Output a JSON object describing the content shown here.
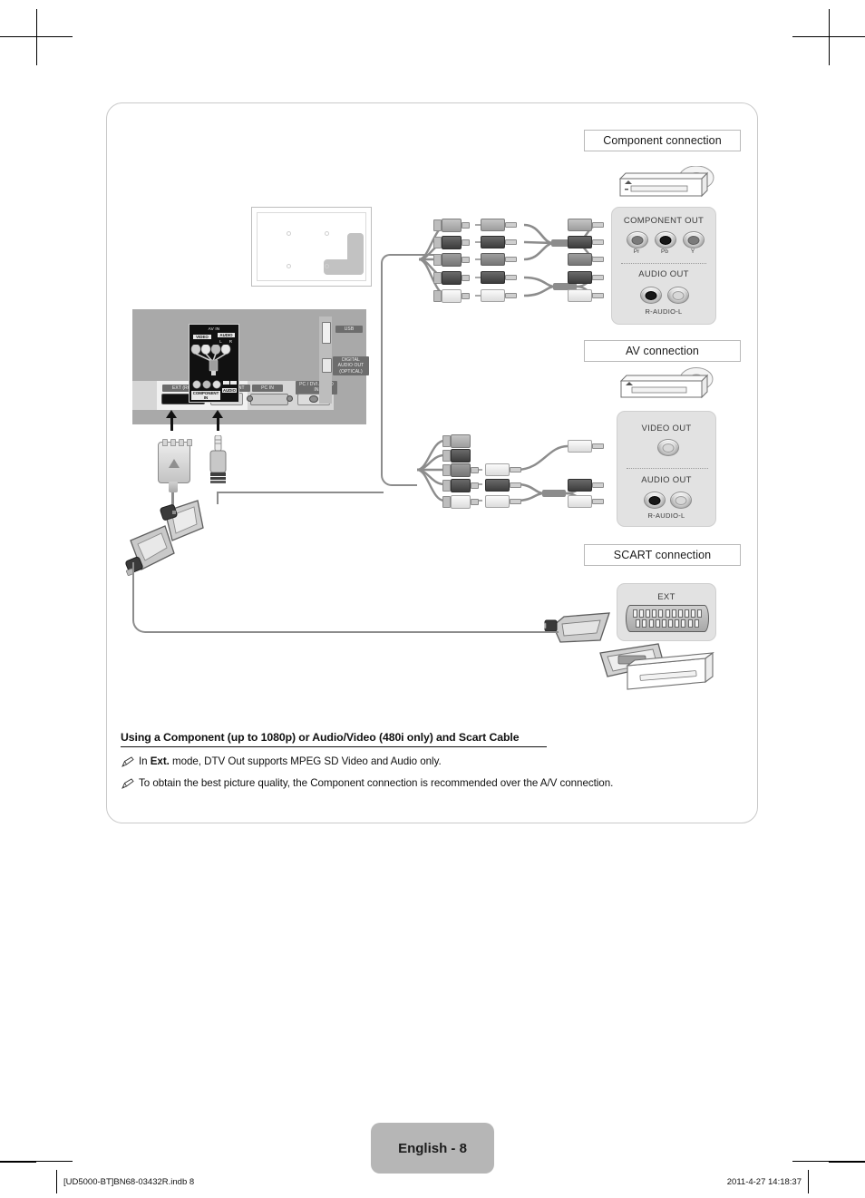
{
  "page": {
    "number_label": "English - 8",
    "footer_left": "[UD5000-BT]BN68-03432R.indb   8",
    "footer_right": "2011-4-27   14:18:37"
  },
  "sections": {
    "component": {
      "label": "Component connection"
    },
    "av": {
      "label": "AV connection"
    },
    "scart": {
      "label": "SCART connection"
    }
  },
  "component_panel": {
    "title": "COMPONENT OUT",
    "jacks": [
      "Pr",
      "Pb",
      "Y"
    ],
    "audio_title": "AUDIO OUT",
    "audio_label": "R-AUDIO-L"
  },
  "av_panel": {
    "video_title": "VIDEO OUT",
    "audio_title": "AUDIO OUT",
    "audio_label": "R-AUDIO-L"
  },
  "scart_panel": {
    "title": "EXT"
  },
  "tv_panel": {
    "labels": {
      "ext_rgb": "EXT (RGB)",
      "component": "COMPONENT",
      "pc_in": "PC IN",
      "pc_dvi_audio_in": "PC / DVI AUDIO IN",
      "usb": "USB",
      "digital_audio_out": "DIGITAL AUDIO OUT (OPTICAL)"
    },
    "callout": {
      "title": "AV IN",
      "video": "VIDEO",
      "audio": "AUDIO",
      "left": "L",
      "right": "R",
      "component_in": "COMPONENT IN",
      "audio_in": "AUDIO"
    }
  },
  "caption": "Using a Component (up to 1080p) or Audio/Video (480i only) and Scart Cable",
  "notes": [
    {
      "prefix": "In ",
      "bold": "Ext.",
      "suffix": " mode, DTV Out supports MPEG SD Video and Audio only."
    },
    {
      "prefix": "",
      "bold": "",
      "suffix": "To obtain the best picture quality, the Component connection is recommended over the A/V connection."
    }
  ],
  "colors": {
    "panel_bg": "#e2e2e2",
    "tv_bg": "#a9a9a9",
    "wire": "#8c8c8c",
    "frame": "#c9c9c9",
    "page_pill": "#b6b6b6"
  }
}
